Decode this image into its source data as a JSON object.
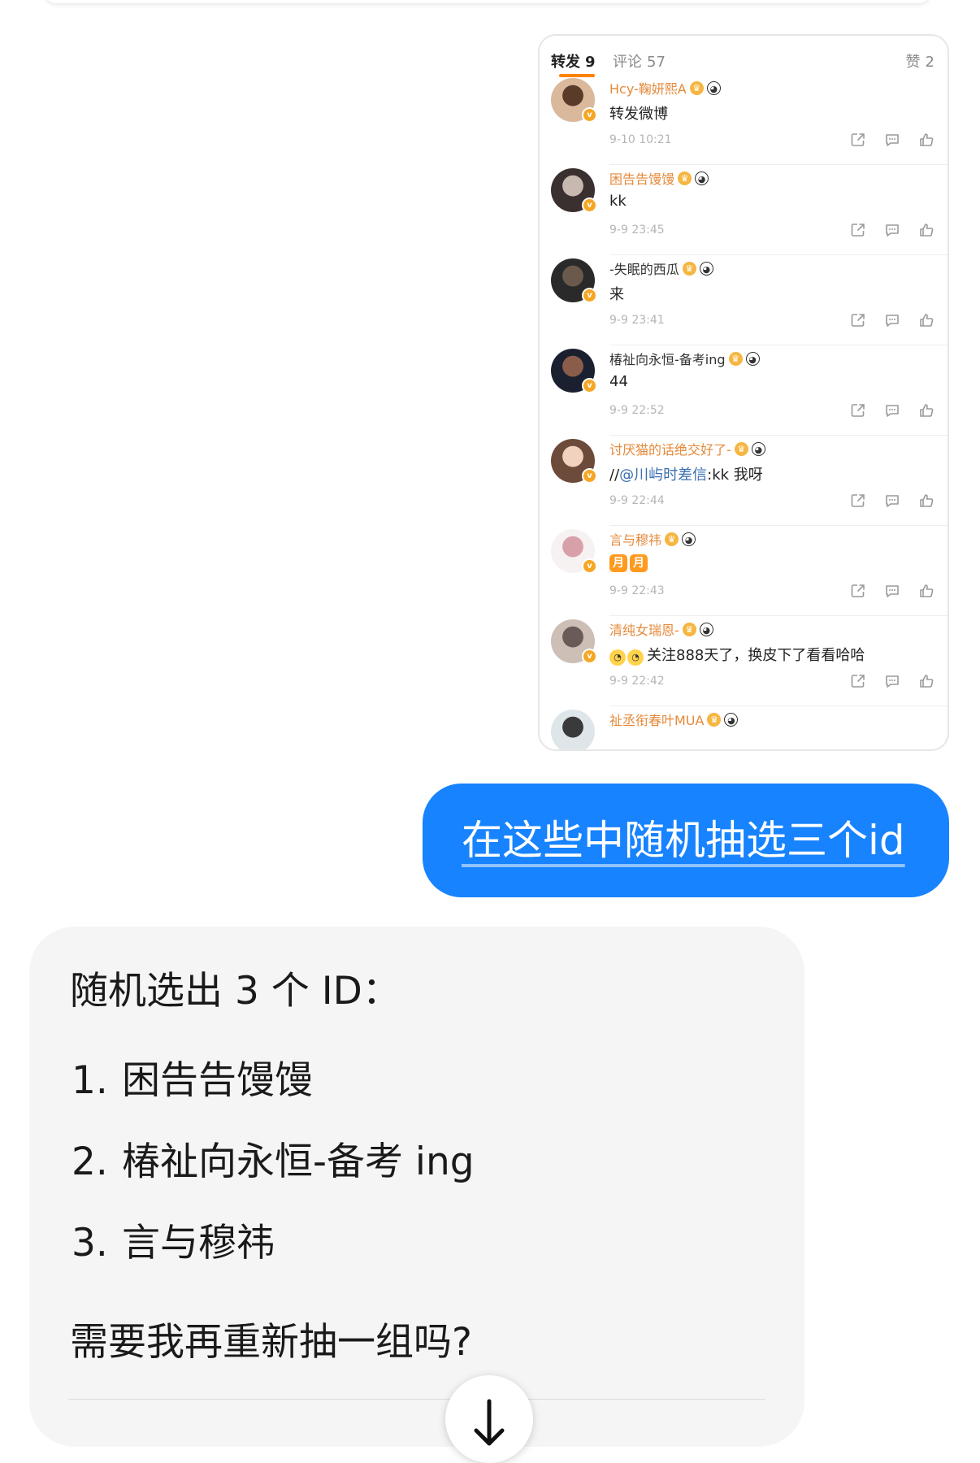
{
  "card": {
    "tabs": [
      {
        "label": "转发",
        "count": "9"
      },
      {
        "label": "评论",
        "count": "57"
      },
      {
        "label": "赞",
        "count": "2"
      }
    ],
    "comments": [
      {
        "name": "Hcy-鞠妍熙A",
        "text": "转发微博",
        "time": "9-10 10:21",
        "name_color": "#e5893a"
      },
      {
        "name": "困告告馒馒",
        "text": "kk",
        "time": "9-9 23:45",
        "name_color": "#e5893a"
      },
      {
        "name": "-失眠的西瓜",
        "text": "来",
        "time": "9-9 23:41",
        "name_color": "#333333"
      },
      {
        "name": "椿祉向永恒-备考ing",
        "text": "44",
        "time": "9-9 22:52",
        "name_color": "#333333"
      },
      {
        "name": "讨厌猫的话绝交好了-",
        "text_prefix": "//",
        "mention": "@川屿时差信",
        "text_suffix": ":kk 我呀",
        "time": "9-9 22:44",
        "name_color": "#e5893a"
      },
      {
        "name": "言与穆祎",
        "pills": [
          "月",
          "月"
        ],
        "time": "9-9 22:43",
        "name_color": "#e5893a"
      },
      {
        "name": "清纯女瑞恩-",
        "text": "关注888天了，换皮下了看看哈哈",
        "time": "9-9 22:42",
        "name_color": "#e5893a"
      },
      {
        "name": "祉丞衔春叶MUA",
        "name_color": "#e5893a"
      }
    ]
  },
  "user_message": "在这些中随机抽选三个id",
  "assistant": {
    "heading": "随机选出 3 个 ID：",
    "items": [
      {
        "num": "1.",
        "text": "困告告馒馒"
      },
      {
        "num": "2.",
        "text": "椿祉向永恒-备考 ing"
      },
      {
        "num": "3.",
        "text": "言与穆祎"
      }
    ],
    "followup": "需要我再重新抽一组吗?"
  },
  "icons": {
    "share": "share-icon",
    "comment": "comment-icon",
    "like": "thumbs-up-icon",
    "scroll": "arrow-down-icon",
    "verified": "verified-badge-icon"
  },
  "colors": {
    "accent": "#ff8200",
    "user_bubble": "#1783ff",
    "assistant_bubble": "#f5f5f5",
    "verified": "#f5a623"
  }
}
